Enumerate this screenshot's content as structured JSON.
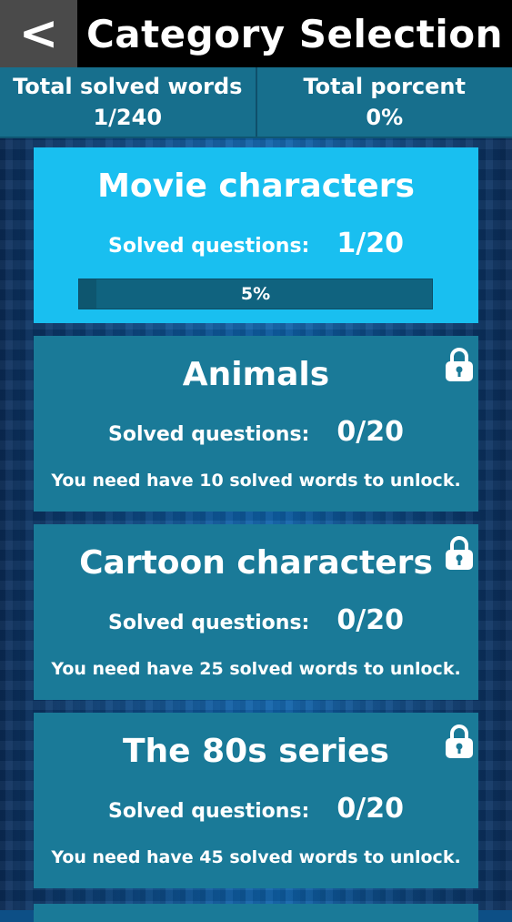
{
  "header": {
    "back_label": "<",
    "title": "Category Selection"
  },
  "stats": {
    "solved_words_label": "Total solved words",
    "solved_words_value": "1/240",
    "percent_label": "Total porcent",
    "percent_value": "0%"
  },
  "categories": [
    {
      "title": "Movie characters",
      "solved_label": "Solved questions:",
      "solved_value": "1/20",
      "progress_percent": 5,
      "progress_text": "5%",
      "locked": false
    },
    {
      "title": "Animals",
      "solved_label": "Solved questions:",
      "solved_value": "0/20",
      "unlock_text": "You need have 10 solved words to unlock.",
      "locked": true,
      "icon": "lock-icon"
    },
    {
      "title": "Cartoon characters",
      "solved_label": "Solved questions:",
      "solved_value": "0/20",
      "unlock_text": "You need have 25 solved words to unlock.",
      "locked": true,
      "icon": "lock-icon"
    },
    {
      "title": "The 80s series",
      "solved_label": "Solved questions:",
      "solved_value": "0/20",
      "unlock_text": "You need have 45 solved words to unlock.",
      "locked": true,
      "icon": "lock-icon"
    }
  ],
  "colors": {
    "active_card": "#19bff0",
    "locked_card": "#1a7a98",
    "header_bg": "#000000",
    "back_button_bg": "#4a4a4a"
  }
}
